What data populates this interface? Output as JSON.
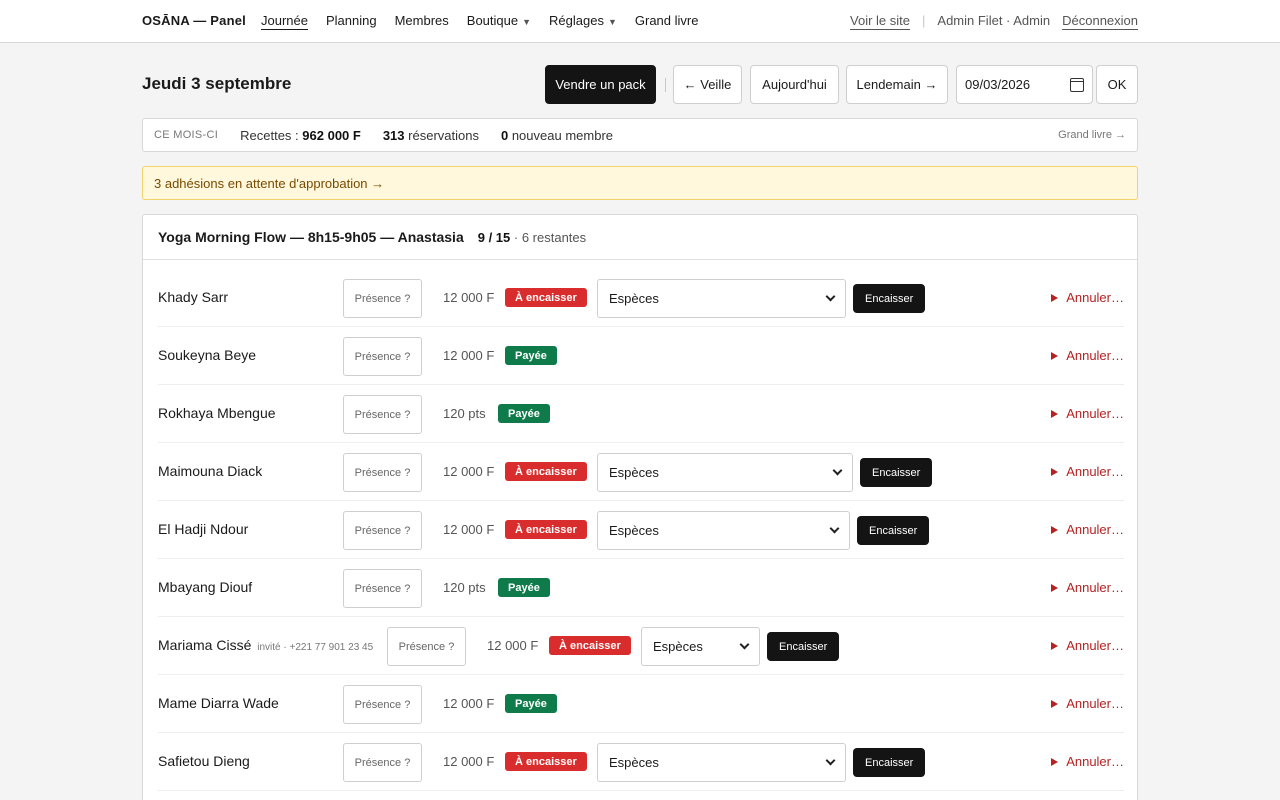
{
  "nav": {
    "brand": "OSĀNA — Panel",
    "items": [
      {
        "label": "Journée",
        "active": true,
        "dropdown": false
      },
      {
        "label": "Planning",
        "active": false,
        "dropdown": false
      },
      {
        "label": "Membres",
        "active": false,
        "dropdown": false
      },
      {
        "label": "Boutique",
        "active": false,
        "dropdown": true
      },
      {
        "label": "Réglages",
        "active": false,
        "dropdown": true
      },
      {
        "label": "Grand livre",
        "active": false,
        "dropdown": false
      }
    ],
    "caret": "▼",
    "view_site": "Voir le site",
    "user": "Admin Filet · Admin",
    "logout": "Déconnexion"
  },
  "header": {
    "title": "Jeudi 3 septembre",
    "sell_pack": "Vendre un pack",
    "prev": "← Veille",
    "today": "Aujourd'hui",
    "next": "Lendemain →",
    "date_value": "09/03/2026",
    "ok": "OK"
  },
  "stats": {
    "label": "CE MOIS-CI",
    "revenue_label": "Recettes :",
    "revenue_value": "962 000 F",
    "bookings_value": "313",
    "bookings_label": "réservations",
    "new_members_value": "0",
    "new_members_label": "nouveau membre",
    "ledger_link": "Grand livre →"
  },
  "alert": {
    "text": "3 adhésions en attente d'approbation →"
  },
  "session": {
    "title": "Yoga Morning Flow — 8h15-9h05 — Anastasia",
    "count": "9 / 15",
    "remaining": "· 6 restantes"
  },
  "colors": {
    "due": "#d92d2d",
    "paid": "#0f7b4b",
    "cancel": "#b52222",
    "alert_bg": "#fff8dc"
  },
  "row_labels": {
    "presence": "Présence ?",
    "cash": "Encaisser",
    "cancel": "Annuler…",
    "method": "Espèces"
  },
  "attendees": [
    {
      "name": "Khady Sarr",
      "guest": "",
      "price": "12 000 F",
      "status": "À encaisser",
      "paid": false
    },
    {
      "name": "Soukeyna Beye",
      "guest": "",
      "price": "12 000 F",
      "status": "Payée",
      "paid": true
    },
    {
      "name": "Rokhaya Mbengue",
      "guest": "",
      "price": "120 pts",
      "status": "Payée",
      "paid": true
    },
    {
      "name": "Maimouna Diack",
      "guest": "",
      "price": "12 000 F",
      "status": "À encaisser",
      "paid": false
    },
    {
      "name": "El Hadji Ndour",
      "guest": "",
      "price": "12 000 F",
      "status": "À encaisser",
      "paid": false
    },
    {
      "name": "Mbayang Diouf",
      "guest": "",
      "price": "120 pts",
      "status": "Payée",
      "paid": true
    },
    {
      "name": "Mariama Cissé",
      "guest": "invité · +221 77 901 23 45",
      "price": "12 000 F",
      "status": "À encaisser",
      "paid": false
    },
    {
      "name": "Mame Diarra Wade",
      "guest": "",
      "price": "12 000 F",
      "status": "Payée",
      "paid": true
    },
    {
      "name": "Safietou Dieng",
      "guest": "",
      "price": "12 000 F",
      "status": "À encaisser",
      "paid": false
    }
  ]
}
